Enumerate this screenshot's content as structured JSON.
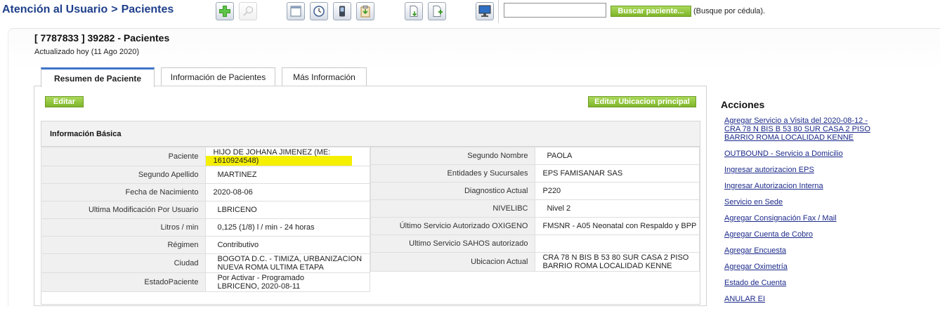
{
  "header": {
    "section": "Atención al Usuario",
    "separator": ">",
    "page": "Pacientes"
  },
  "toolbar": {
    "icons": [
      "add-icon",
      "search-icon",
      "window-icon",
      "clock-icon",
      "mobile-icon",
      "clipboard-icon",
      "export-icon",
      "import-icon",
      "monitor-icon"
    ],
    "search_placeholder": "",
    "search_value": "",
    "search_button": "Buscar paciente...",
    "search_hint": "(Busque por cédula)."
  },
  "record": {
    "title": "[ 7787833 ] 39282 - Pacientes",
    "updated": "Actualizado hoy (11 Ago 2020)"
  },
  "tabs": [
    {
      "label": "Resumen de Paciente",
      "active": true
    },
    {
      "label": "Información de Pacientes",
      "active": false
    },
    {
      "label": "Más Información",
      "active": false
    }
  ],
  "buttons": {
    "edit": "Editar",
    "edit_location": "Editar Ubicacion principal"
  },
  "basic_info": {
    "title": "Información Básica",
    "left": [
      {
        "label": "Paciente",
        "value": "HIJO DE JOHANA JIMENEZ (ME:\n1610924548)"
      },
      {
        "label": "Segundo Apellido",
        "value": "MARTINEZ"
      },
      {
        "label": "Fecha de Nacimiento",
        "value": "2020-08-06"
      },
      {
        "label": "Ultima Modificación Por Usuario",
        "value": "LBRICENO"
      },
      {
        "label": "Litros / min",
        "value": "0,125 (1/8) l / min - 24 horas"
      },
      {
        "label": "Régimen",
        "value": "Contributivo"
      },
      {
        "label": "Ciudad",
        "value": "BOGOTA D.C. - TIMIZA, URBANIZACION\nNUEVA ROMA ULTIMA ETAPA"
      },
      {
        "label": "EstadoPaciente",
        "value": "Por Activar - Programado\nLBRICENO, 2020-08-11"
      }
    ],
    "right": [
      {
        "label": "Segundo Nombre",
        "value": "PAOLA"
      },
      {
        "label": "Entidades y Sucursales",
        "value": "EPS FAMISANAR SAS"
      },
      {
        "label": "Diagnostico Actual",
        "value": "P220"
      },
      {
        "label": "NIVELIBC",
        "value": "Nivel 2"
      },
      {
        "label": "Último Servicio Autorizado OXIGENO",
        "value": "FMSNR - A05 Neonatal con Respaldo y BPP"
      },
      {
        "label": "Ultimo Servicio SAHOS autorizado",
        "value": ""
      },
      {
        "label": "Ubicacion Actual",
        "value": "CRA 78 N BIS B 53 80 SUR CASA 2 PISO\nBARRIO ROMA LOCALIDAD KENNE"
      }
    ]
  },
  "actions": {
    "title": "Acciones",
    "items": [
      "Agregar Servicio a Visita del 2020-08-12 -\nCRA 78 N BIS B 53 80 SUR CASA 2 PISO\nBARRIO ROMA LOCALIDAD KENNE",
      "OUTBOUND - Servicio a Domicilio",
      "Ingresar autorizacion EPS",
      "Ingresar Autorizacion Interna",
      "Servicio en Sede",
      "Agregar Consignación Fax / Mail",
      "Agregar Cuenta de Cobro",
      "Agregar Encuesta",
      "Agregar Oximetría",
      "Estado de Cuenta",
      "ANULAR EI"
    ]
  },
  "colors": {
    "breadcrumb": "#1e3f8a",
    "green_button": "#8cc43c",
    "highlight": "#f5ef00",
    "link": "#1b2a8a",
    "tab_active_border": "#3e74c9"
  }
}
